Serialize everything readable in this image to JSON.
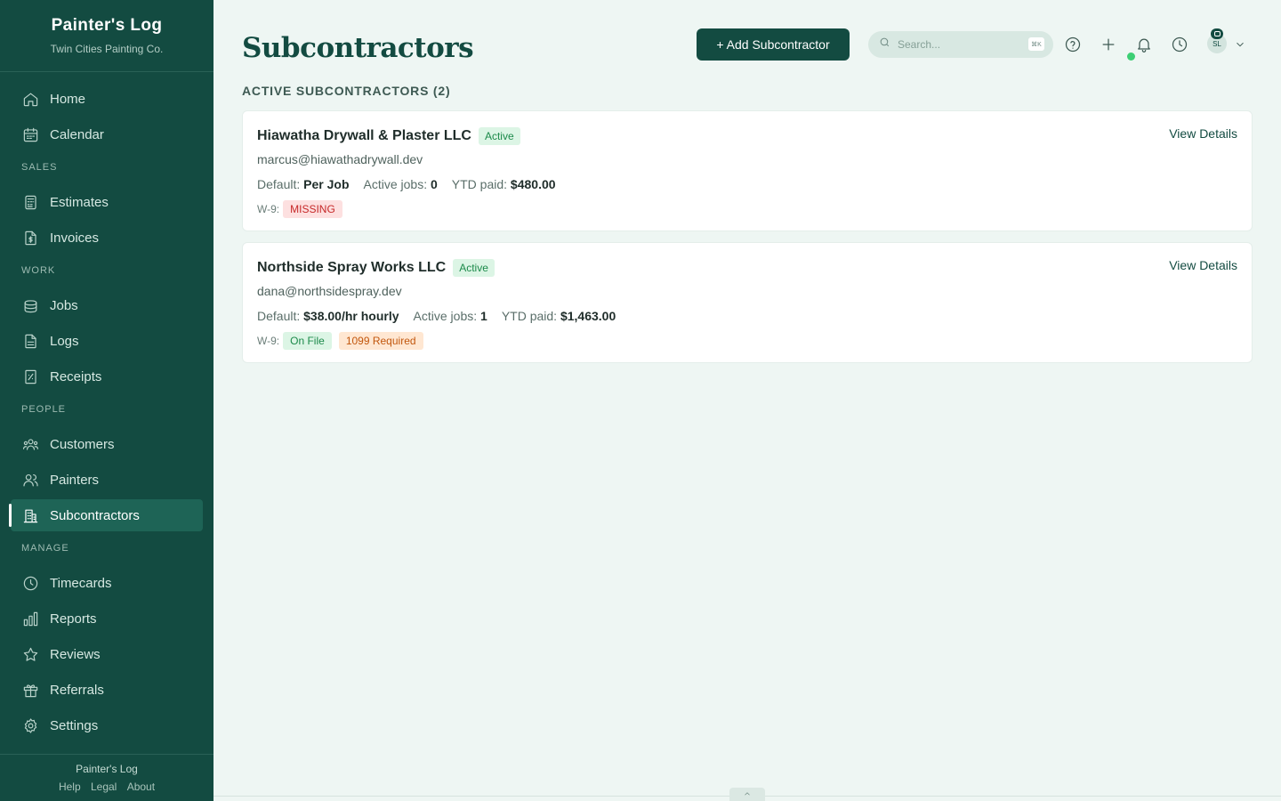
{
  "sidebar": {
    "brand_title": "Painter's Log",
    "brand_subtitle": "Twin Cities Painting Co.",
    "items": {
      "home": "Home",
      "calendar": "Calendar",
      "estimates": "Estimates",
      "invoices": "Invoices",
      "jobs": "Jobs",
      "logs": "Logs",
      "receipts": "Receipts",
      "customers": "Customers",
      "painters": "Painters",
      "subcontractors": "Subcontractors",
      "timecards": "Timecards",
      "reports": "Reports",
      "reviews": "Reviews",
      "referrals": "Referrals",
      "settings": "Settings"
    },
    "sections": {
      "sales": "SALES",
      "work": "WORK",
      "people": "PEOPLE",
      "manage": "MANAGE"
    },
    "active_item": "Subcontractors",
    "footer": {
      "title": "Painter's Log",
      "help": "Help",
      "legal": "Legal",
      "about": "About"
    }
  },
  "header": {
    "title": "Subcontractors",
    "add_button": "+ Add Subcontractor",
    "search_placeholder": "Search...",
    "search_shortcut": "⌘K",
    "icons": [
      "help-icon",
      "plus-icon",
      "bell-icon",
      "clock-icon"
    ],
    "avatar_initials": "SL"
  },
  "list": {
    "heading": "ACTIVE SUBCONTRACTORS (2)",
    "cards": [
      {
        "name": "Hiawatha Drywall & Plaster LLC",
        "status": "Active",
        "email": "marcus@hiawathadrywall.dev",
        "default_label": "Default:",
        "default_value": "Per Job",
        "active_jobs_label": "Active jobs:",
        "active_jobs_value": "0",
        "ytd_label": "YTD paid:",
        "ytd_value": "$480.00",
        "w9_label": "W-9:",
        "w9_status": "MISSING",
        "view_details": "View Details"
      },
      {
        "name": "Northside Spray Works LLC",
        "status": "Active",
        "email": "dana@northsidespray.dev",
        "default_label": "Default:",
        "default_value": "$38.00/hr hourly",
        "active_jobs_label": "Active jobs:",
        "active_jobs_value": "1",
        "ytd_label": "YTD paid:",
        "ytd_value": "$1,463.00",
        "w9_label": "W-9:",
        "w9_status": "On File",
        "form_1099": "1099 Required",
        "view_details": "View Details"
      }
    ]
  },
  "colors": {
    "sidebar_bg": "#134b41",
    "accent": "#134b41",
    "page_bg": "#eef6f3",
    "success": "#1c8a4a",
    "danger": "#c62828",
    "warning": "#c2570e"
  }
}
